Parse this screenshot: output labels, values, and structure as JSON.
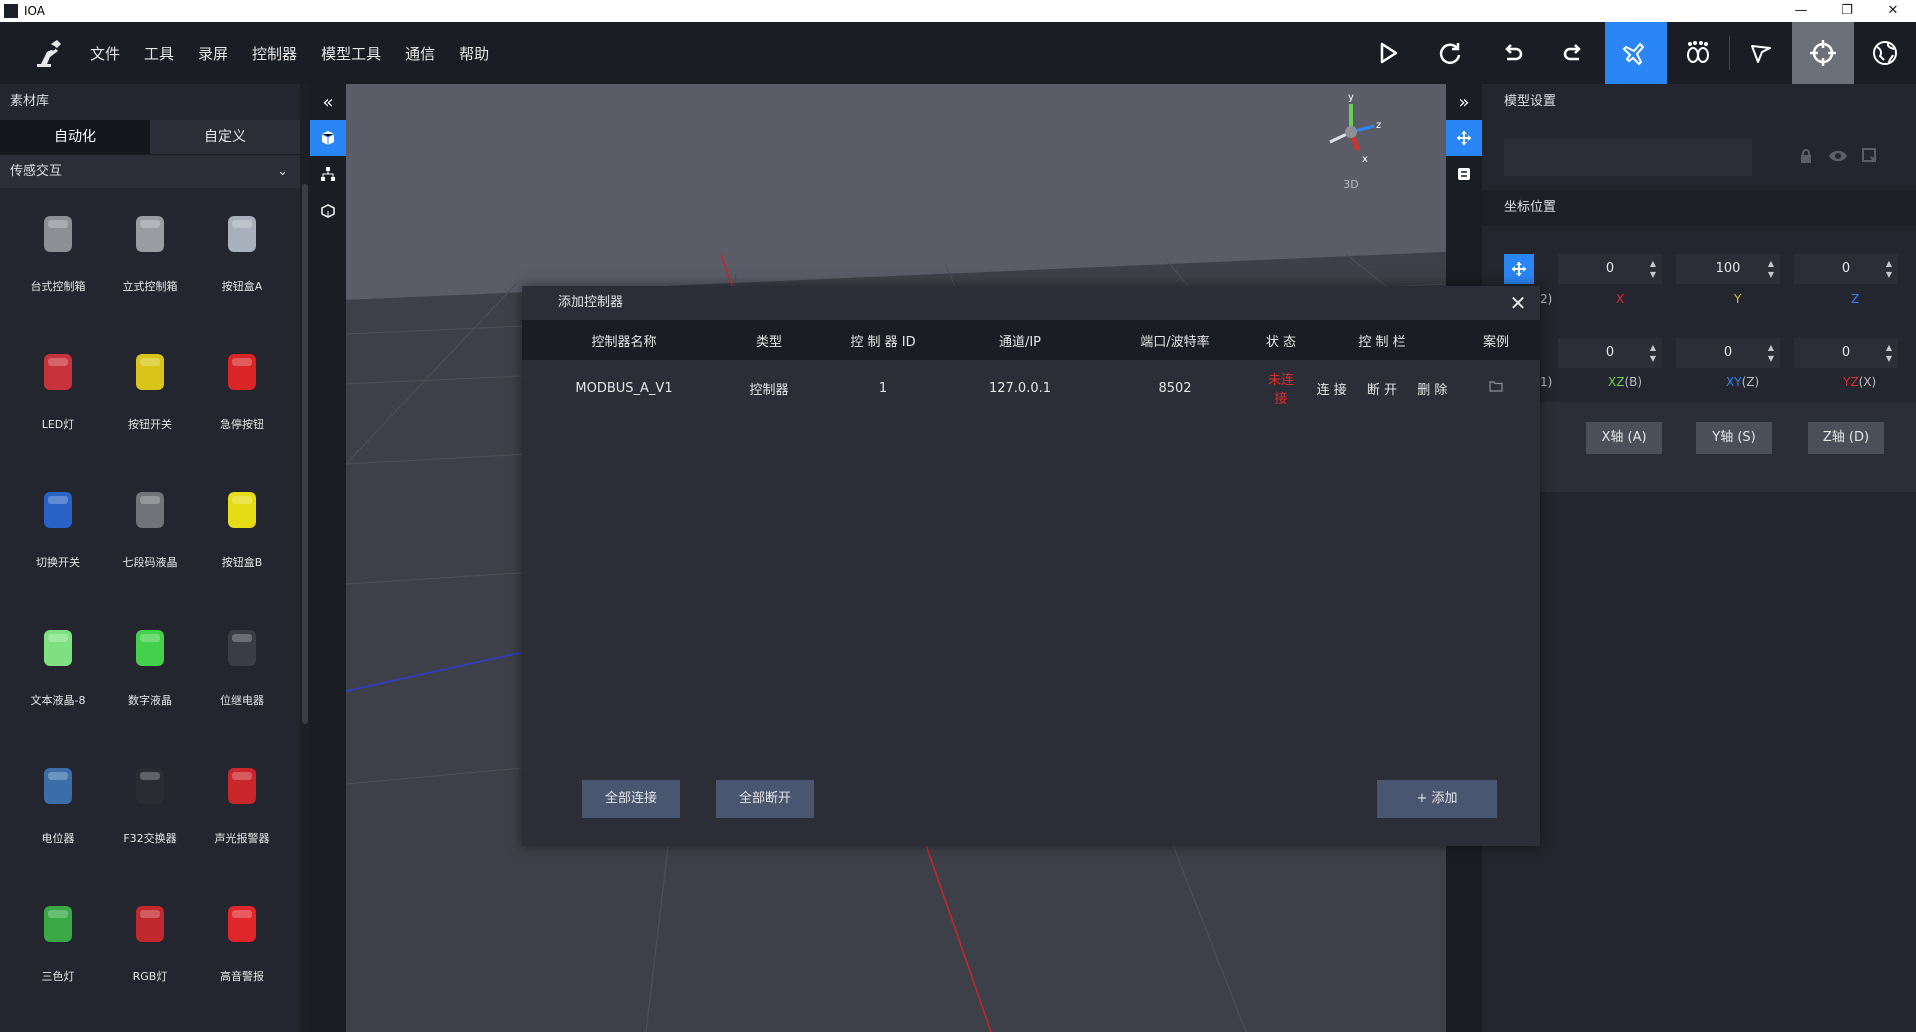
{
  "window": {
    "title": "IOA",
    "controls": [
      "—",
      "❐",
      "✕"
    ]
  },
  "menu": [
    "文件",
    "工具",
    "录屏",
    "控制器",
    "模型工具",
    "通信",
    "帮助"
  ],
  "left_panel": {
    "title": "素材库",
    "tabs": [
      "自动化",
      "自定义"
    ],
    "category": "传感交互",
    "assets": [
      {
        "label": "台式控制箱",
        "icon": "box-gray-icon",
        "color": "#8d8f94"
      },
      {
        "label": "立式控制箱",
        "icon": "pole-box-icon",
        "color": "#9a9ca1"
      },
      {
        "label": "按钮盒A",
        "icon": "button-box-icon",
        "color": "#a8b0bb"
      },
      {
        "label": "LED灯",
        "icon": "led-icon",
        "color": "#c8323a"
      },
      {
        "label": "按钮开关",
        "icon": "button-switch-icon",
        "color": "#d9c41a"
      },
      {
        "label": "急停按钮",
        "icon": "emergency-stop-icon",
        "color": "#d92525"
      },
      {
        "label": "切换开关",
        "icon": "selector-switch-icon",
        "color": "#2a63c8"
      },
      {
        "label": "七段码液晶",
        "icon": "seven-segment-icon",
        "color": "#707378"
      },
      {
        "label": "按钮盒B",
        "icon": "yellow-box-icon",
        "color": "#e6dc16"
      },
      {
        "label": "文本液晶-8",
        "icon": "text-lcd-icon",
        "color": "#7ee081"
      },
      {
        "label": "数字液晶",
        "icon": "digital-lcd-icon",
        "color": "#44d04d"
      },
      {
        "label": "位继电器",
        "icon": "relay-icon",
        "color": "#3a3d46"
      },
      {
        "label": "电位器",
        "icon": "potentiometer-icon",
        "color": "#3b6ea8"
      },
      {
        "label": "F32交换器",
        "icon": "switch-module-icon",
        "color": "#2a2c33"
      },
      {
        "label": "声光报警器",
        "icon": "alarm-light-icon",
        "color": "#c9252b"
      },
      {
        "label": "三色灯",
        "icon": "tower-light-icon",
        "color": "#39a845"
      },
      {
        "label": "RGB灯",
        "icon": "rgb-light-icon",
        "color": "#c0282d"
      },
      {
        "label": "高音警报",
        "icon": "siren-icon",
        "color": "#e0262a"
      }
    ]
  },
  "viewport": {
    "gizmo_label": "3D",
    "axes": [
      "y",
      "z",
      "x"
    ]
  },
  "right_panel": {
    "title": "模型设置",
    "coord_title": "坐标位置",
    "position": {
      "x": "0",
      "y": "100",
      "z": "0"
    },
    "position_labels": [
      "X",
      "Y",
      "Z"
    ],
    "row_tag_1": "2)",
    "rotation": {
      "xz": "0",
      "xy": "0",
      "yz": "0"
    },
    "rotation_labels": [
      {
        "axis": "XZ",
        "key": "(B)"
      },
      {
        "axis": "XY",
        "key": "(Z)"
      },
      {
        "axis": "YZ",
        "key": "(X)"
      }
    ],
    "row_tag_2": "1)",
    "axis_buttons": [
      "X轴 (A)",
      "Y轴 (S)",
      "Z轴 (D)"
    ]
  },
  "modal": {
    "title": "添加控制器",
    "columns": [
      "控制器名称",
      "类型",
      "控 制 器 ID",
      "通道/IP",
      "端口/波特率",
      "状 态",
      "控 制 栏",
      "案例"
    ],
    "rows": [
      {
        "name": "MODBUS_A_V1",
        "type": "控制器",
        "id": "1",
        "ip": "127.0.0.1",
        "port": "8502",
        "status": "未连接",
        "actions": [
          "连 接",
          "断 开",
          "删 除"
        ]
      }
    ],
    "connect_all": "全部连接",
    "disconnect_all": "全部断开",
    "add": "+ 添加"
  },
  "colors": {
    "accent": "#2b86f5",
    "status_disconnected": "#e02b2b",
    "x_axis": "#e02b2b",
    "y_axis": "#c8c832",
    "z_axis": "#2b86f5",
    "xz_label": "#6bd04d"
  }
}
